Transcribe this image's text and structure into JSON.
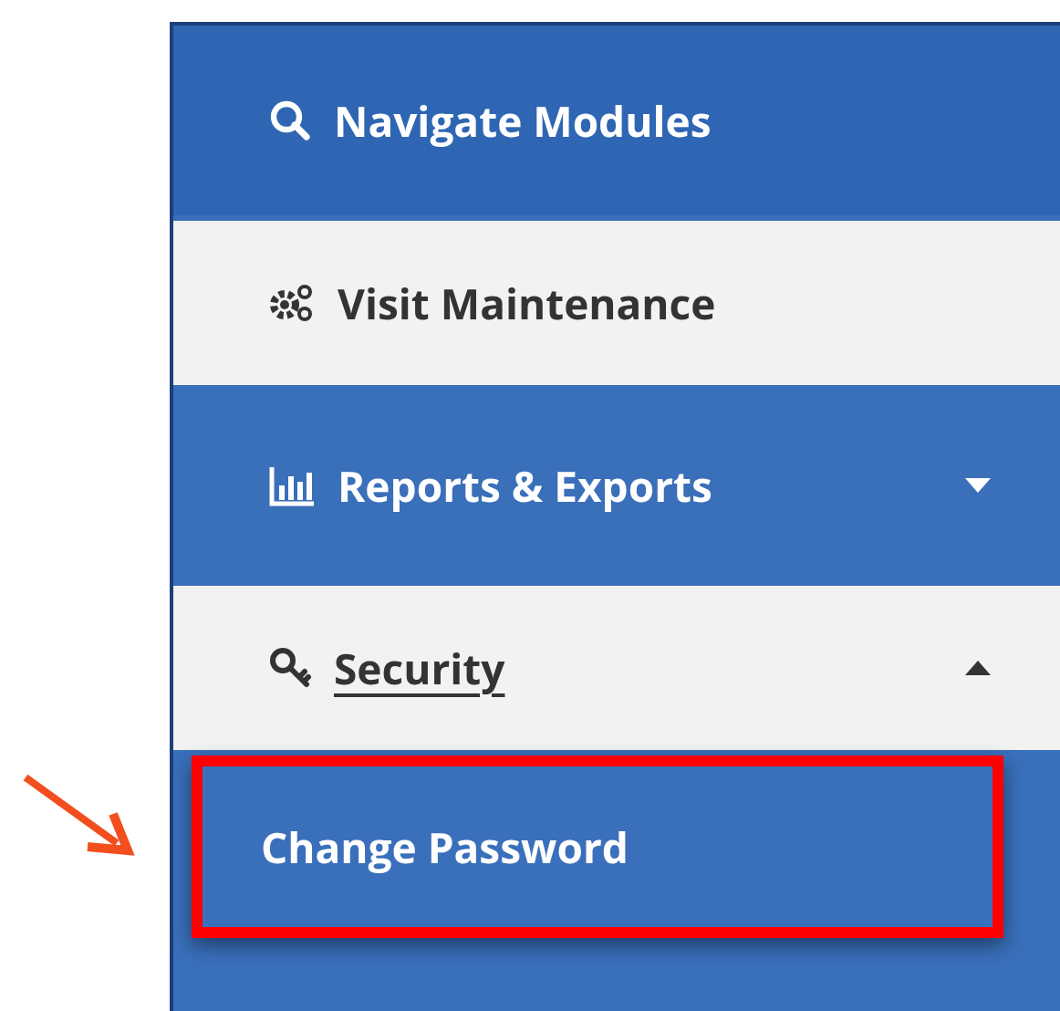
{
  "menu": {
    "items": [
      {
        "label": "Navigate Modules",
        "kind": "link",
        "selected": false
      },
      {
        "label": "Visit Maintenance",
        "kind": "link",
        "selected": false
      },
      {
        "label": "Reports & Exports",
        "kind": "group",
        "selected": false,
        "expanded": false
      },
      {
        "label": "Security",
        "kind": "group",
        "selected": true,
        "expanded": true,
        "children": [
          {
            "label": "Change Password",
            "highlighted": true
          }
        ]
      }
    ]
  }
}
